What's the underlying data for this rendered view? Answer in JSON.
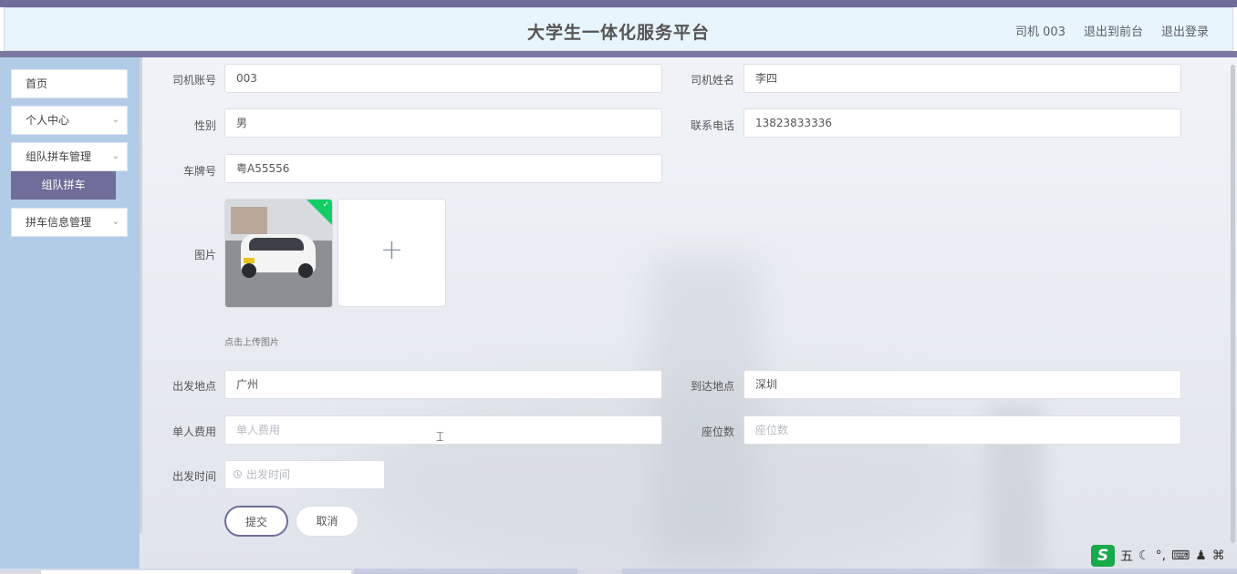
{
  "header": {
    "title": "大学生一体化服务平台",
    "user": "司机 003",
    "back_to_front": "退出到前台",
    "logout": "退出登录"
  },
  "sidebar": {
    "items": [
      {
        "label": "首页"
      },
      {
        "label": "个人中心"
      },
      {
        "label": "组队拼车管理"
      },
      {
        "label": "拼车信息管理"
      }
    ],
    "active_sub": "组队拼车"
  },
  "form": {
    "driver_account": {
      "label": "司机账号",
      "value": "003"
    },
    "driver_name": {
      "label": "司机姓名",
      "value": "李四"
    },
    "gender": {
      "label": "性别",
      "value": "男"
    },
    "phone": {
      "label": "联系电话",
      "value": "13823833336"
    },
    "plate": {
      "label": "车牌号",
      "value": "粤A55556"
    },
    "image": {
      "label": "图片",
      "upload_tip": "点击上传图片"
    },
    "departure": {
      "label": "出发地点",
      "value": "广州"
    },
    "arrival": {
      "label": "到达地点",
      "value": "深圳"
    },
    "fee": {
      "label": "单人费用",
      "placeholder": "单人费用"
    },
    "seats": {
      "label": "座位数",
      "placeholder": "座位数"
    },
    "depart_time": {
      "label": "出发时间",
      "placeholder": "出发时间"
    },
    "submit": "提交",
    "cancel": "取消"
  },
  "ime": {
    "logo": "S",
    "mode": "五"
  },
  "colors": {
    "accent": "#6f6d99",
    "sidebar": "#b2cce8",
    "header_bg": "#e8f5fc",
    "success": "#13ce66"
  }
}
